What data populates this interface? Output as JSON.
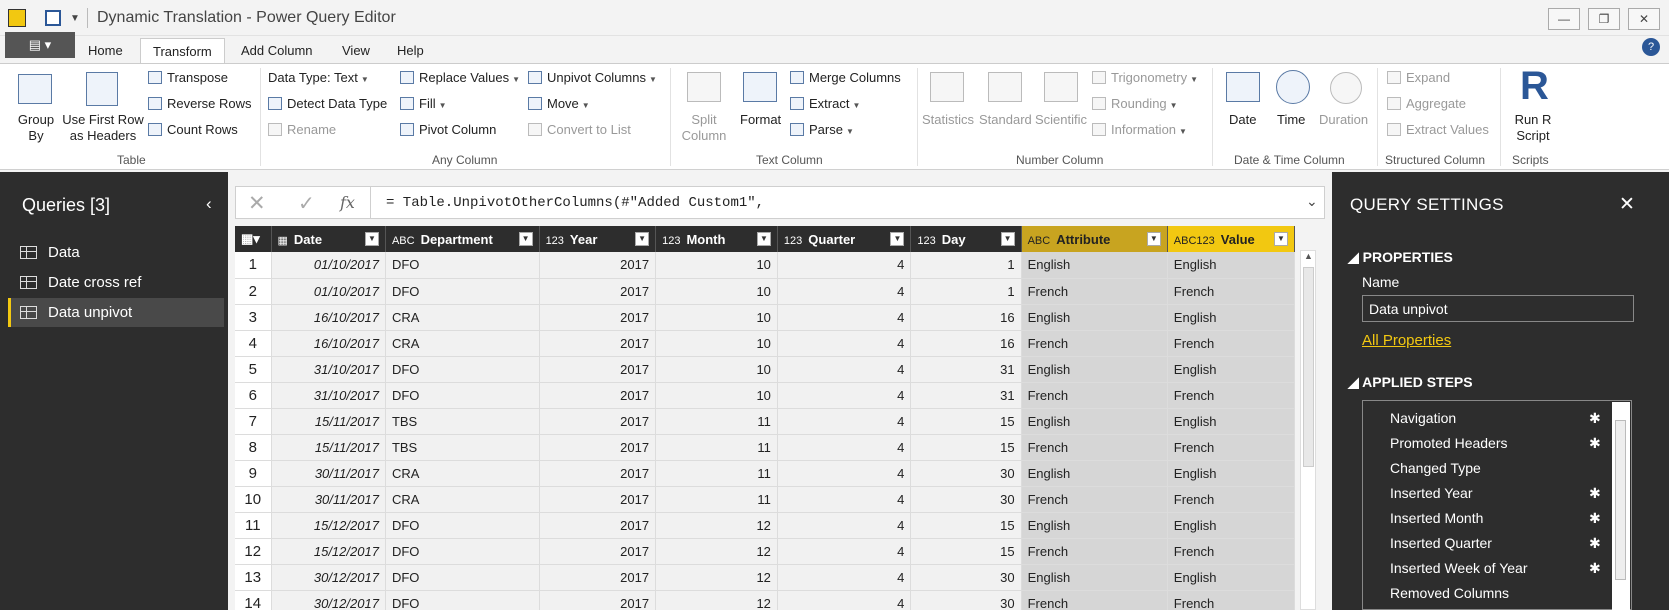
{
  "window": {
    "title": "Dynamic Translation - Power Query Editor",
    "controls": [
      "—",
      "❐",
      "✕"
    ]
  },
  "ribbon_tabs": {
    "file": "▤ ▾",
    "home": "Home",
    "transform": "Transform",
    "add_column": "Add Column",
    "view": "View",
    "help": "Help"
  },
  "ribbon": {
    "table": {
      "group_by": "Group By",
      "use_first_row": "Use First Row as Headers",
      "transpose": "Transpose",
      "reverse_rows": "Reverse Rows",
      "count_rows": "Count Rows",
      "group_label": "Table"
    },
    "any_column": {
      "data_type": "Data Type: Text",
      "detect_data_type": "Detect Data Type",
      "rename": "Rename",
      "replace_values": "Replace Values",
      "fill": "Fill",
      "pivot_column": "Pivot Column",
      "unpivot_columns": "Unpivot Columns",
      "move": "Move",
      "convert_to_list": "Convert to List",
      "group_label": "Any Column"
    },
    "text_column": {
      "split_column": "Split Column",
      "format": "Format",
      "merge_columns": "Merge Columns",
      "extract": "Extract",
      "parse": "Parse",
      "group_label": "Text Column"
    },
    "number_column": {
      "statistics": "Statistics",
      "standard": "Standard",
      "scientific": "Scientific",
      "trigonometry": "Trigonometry",
      "rounding": "Rounding",
      "information": "Information",
      "group_label": "Number Column"
    },
    "date_time_column": {
      "date": "Date",
      "time": "Time",
      "duration": "Duration",
      "group_label": "Date & Time Column"
    },
    "structured_column": {
      "expand": "Expand",
      "aggregate": "Aggregate",
      "extract_values": "Extract Values",
      "group_label": "Structured Column"
    },
    "scripts": {
      "run_r_script": "Run R Script",
      "group_label": "Scripts"
    }
  },
  "queries": {
    "title": "Queries [3]",
    "items": [
      {
        "label": "Data",
        "selected": false
      },
      {
        "label": "Date cross ref",
        "selected": false
      },
      {
        "label": "Data unpivot",
        "selected": true
      }
    ]
  },
  "formula_bar": {
    "formula": "= Table.UnpivotOtherColumns(#\"Added Custom1\","
  },
  "grid": {
    "columns": [
      {
        "name": "Date",
        "type": "date"
      },
      {
        "name": "Department",
        "type": "text"
      },
      {
        "name": "Year",
        "type": "number"
      },
      {
        "name": "Month",
        "type": "number"
      },
      {
        "name": "Quarter",
        "type": "number"
      },
      {
        "name": "Day",
        "type": "number"
      },
      {
        "name": "Attribute",
        "type": "text"
      },
      {
        "name": "Value",
        "type": "any"
      }
    ],
    "rows": [
      [
        "01/10/2017",
        "DFO",
        "2017",
        "10",
        "4",
        "1",
        "English",
        "English"
      ],
      [
        "01/10/2017",
        "DFO",
        "2017",
        "10",
        "4",
        "1",
        "French",
        "French"
      ],
      [
        "16/10/2017",
        "CRA",
        "2017",
        "10",
        "4",
        "16",
        "English",
        "English"
      ],
      [
        "16/10/2017",
        "CRA",
        "2017",
        "10",
        "4",
        "16",
        "French",
        "French"
      ],
      [
        "31/10/2017",
        "DFO",
        "2017",
        "10",
        "4",
        "31",
        "English",
        "English"
      ],
      [
        "31/10/2017",
        "DFO",
        "2017",
        "10",
        "4",
        "31",
        "French",
        "French"
      ],
      [
        "15/11/2017",
        "TBS",
        "2017",
        "11",
        "4",
        "15",
        "English",
        "English"
      ],
      [
        "15/11/2017",
        "TBS",
        "2017",
        "11",
        "4",
        "15",
        "French",
        "French"
      ],
      [
        "30/11/2017",
        "CRA",
        "2017",
        "11",
        "4",
        "30",
        "English",
        "English"
      ],
      [
        "30/11/2017",
        "CRA",
        "2017",
        "11",
        "4",
        "30",
        "French",
        "French"
      ],
      [
        "15/12/2017",
        "DFO",
        "2017",
        "12",
        "4",
        "15",
        "English",
        "English"
      ],
      [
        "15/12/2017",
        "DFO",
        "2017",
        "12",
        "4",
        "15",
        "French",
        "French"
      ],
      [
        "30/12/2017",
        "DFO",
        "2017",
        "12",
        "4",
        "30",
        "English",
        "English"
      ],
      [
        "30/12/2017",
        "DFO",
        "2017",
        "12",
        "4",
        "30",
        "French",
        "French"
      ]
    ]
  },
  "query_settings": {
    "title": "QUERY SETTINGS",
    "properties_header": "PROPERTIES",
    "name_label": "Name",
    "name_value": "Data unpivot",
    "all_properties": "All Properties",
    "applied_steps_header": "APPLIED STEPS",
    "steps": [
      {
        "label": "Navigation",
        "gear": true
      },
      {
        "label": "Promoted Headers",
        "gear": true
      },
      {
        "label": "Changed Type",
        "gear": false
      },
      {
        "label": "Inserted Year",
        "gear": true
      },
      {
        "label": "Inserted Month",
        "gear": true
      },
      {
        "label": "Inserted Quarter",
        "gear": true
      },
      {
        "label": "Inserted Week of Year",
        "gear": true
      },
      {
        "label": "Removed Columns",
        "gear": false
      }
    ]
  },
  "colors": {
    "accent": "#f2c811",
    "attribute_header": "#c8a420",
    "panel_dark": "#2d2d2d"
  }
}
